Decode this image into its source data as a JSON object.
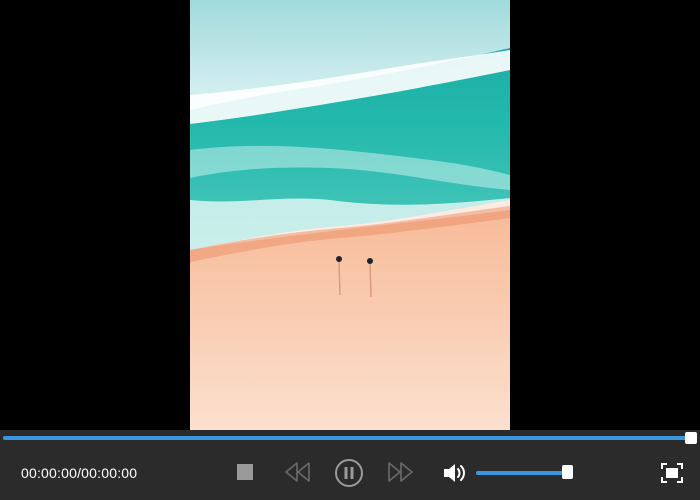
{
  "player": {
    "time_display": "00:00:00/00:00:00",
    "progress_fraction": 1.0,
    "volume_fraction": 0.95,
    "accent_color": "#3a96dd"
  },
  "icons": {
    "stop": "stop-icon",
    "rewind": "rewind-icon",
    "pause": "pause-icon",
    "forward": "fast-forward-icon",
    "volume": "volume-icon",
    "fullscreen": "fullscreen-icon"
  }
}
